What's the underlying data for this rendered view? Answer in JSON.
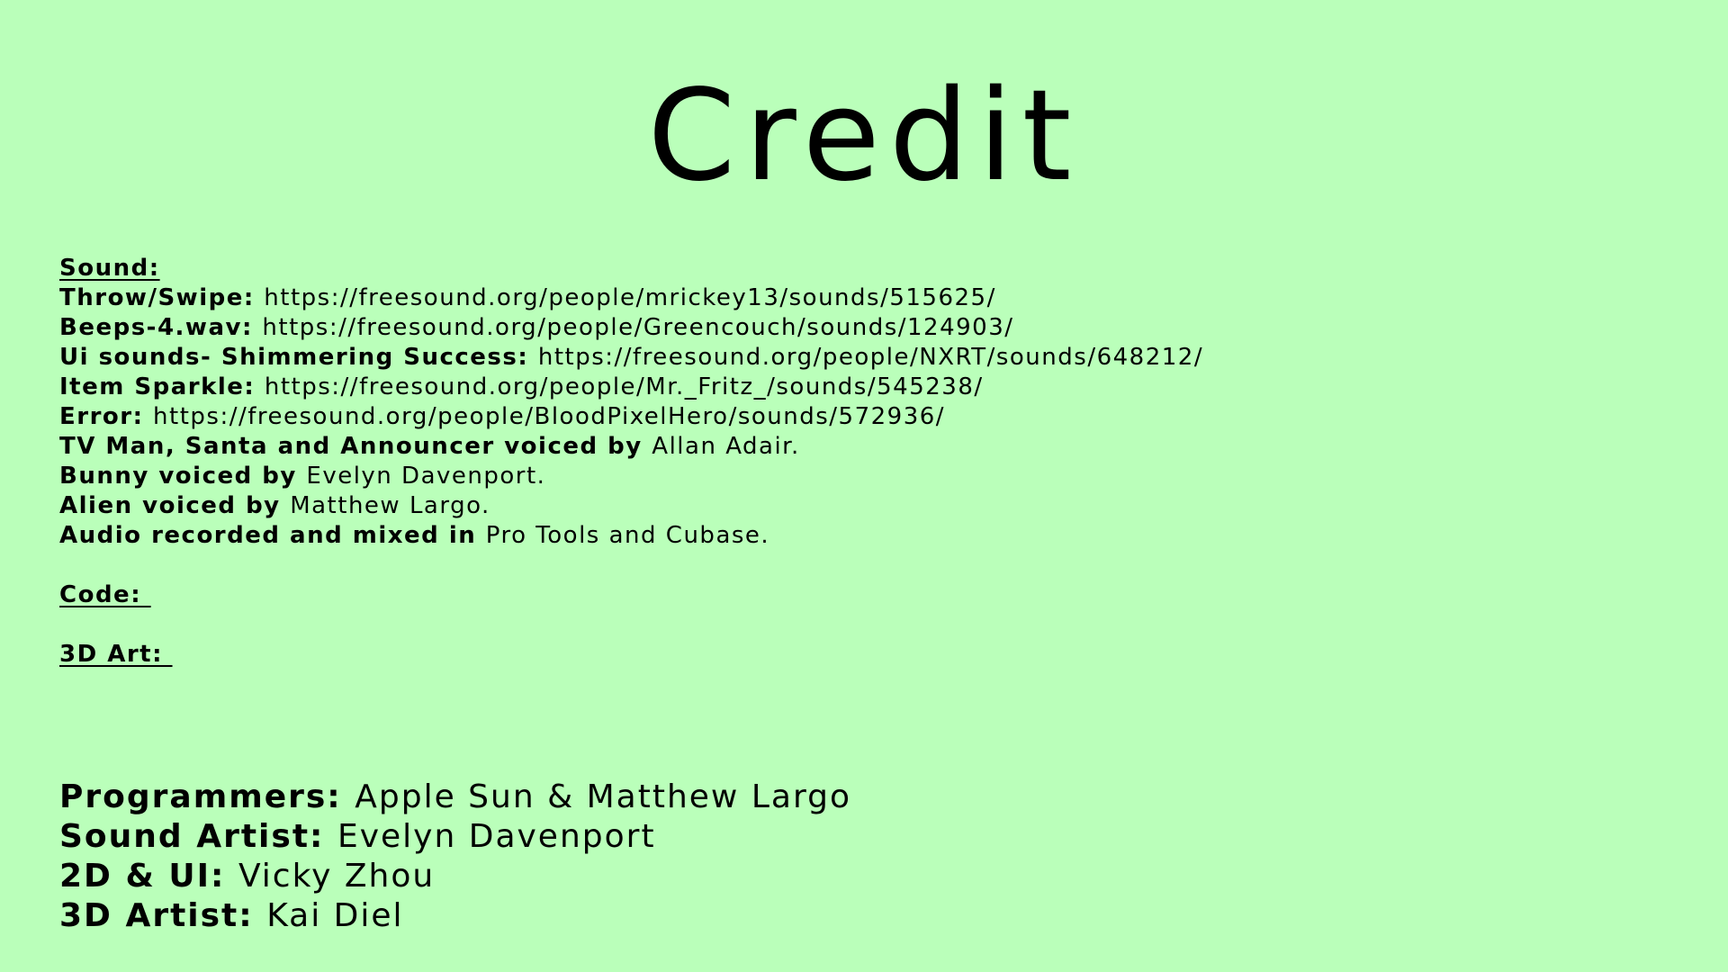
{
  "title": "Credit",
  "sound": {
    "heading": "Sound:",
    "lines": [
      {
        "label": "Throw/Swipe: ",
        "value": "https://freesound.org/people/mrickey13/sounds/515625/"
      },
      {
        "label": "Beeps-4.wav: ",
        "value": "https://freesound.org/people/Greencouch/sounds/124903/"
      },
      {
        "label": "Ui sounds- Shimmering Success: ",
        "value": "https://freesound.org/people/NXRT/sounds/648212/"
      },
      {
        "label": "Item Sparkle: ",
        "value": "https://freesound.org/people/Mr._Fritz_/sounds/545238/"
      },
      {
        "label": "Error: ",
        "value": "https://freesound.org/people/BloodPixelHero/sounds/572936/"
      },
      {
        "label": "TV Man, Santa and Announcer voiced by ",
        "value": "Allan Adair."
      },
      {
        "label": "Bunny voiced by ",
        "value": "Evelyn Davenport."
      },
      {
        "label": "Alien voiced by ",
        "value": "Matthew Largo."
      },
      {
        "label": "Audio recorded and mixed in ",
        "value": "Pro Tools and Cubase."
      }
    ]
  },
  "code": {
    "heading": "Code: "
  },
  "art3d": {
    "heading": "3D Art: "
  },
  "team": [
    {
      "label": "Programmers: ",
      "value": "Apple Sun & Matthew Largo"
    },
    {
      "label": "Sound Artist: ",
      "value": "Evelyn Davenport"
    },
    {
      "label": "2D & UI: ",
      "value": "Vicky Zhou"
    },
    {
      "label": "3D Artist: ",
      "value": "Kai Diel"
    }
  ]
}
